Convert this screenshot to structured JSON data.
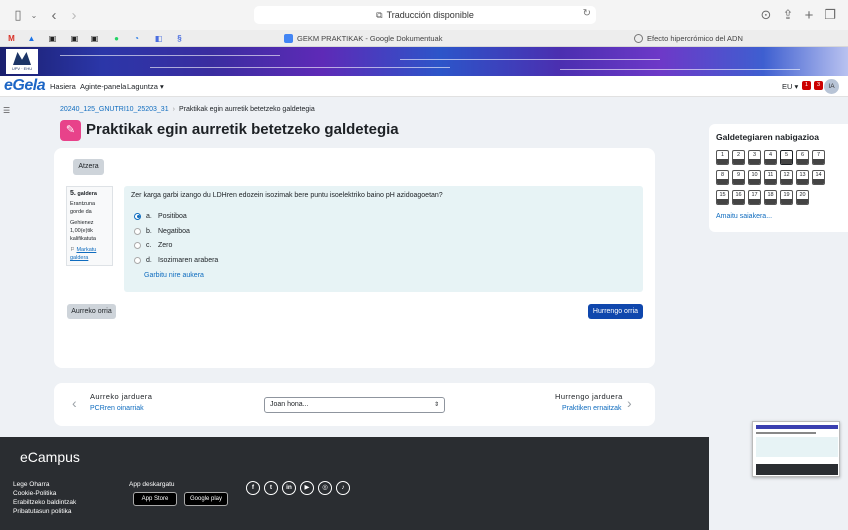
{
  "browser": {
    "address_text": "Traducción disponible",
    "tabs": [
      {
        "label": "GEKM PRAKTIKAK - Google Dokumentuak"
      },
      {
        "label": "Efecto hipercrómico del ADN"
      }
    ],
    "favorites": [
      {
        "icon": "gmail-icon",
        "glyph": "M",
        "color": "#d93025"
      },
      {
        "icon": "drive-icon",
        "glyph": "▲",
        "color": "#1a73e8"
      },
      {
        "icon": "bookmark-1-icon",
        "glyph": "▣",
        "color": "#222"
      },
      {
        "icon": "bookmark-2-icon",
        "glyph": "▣",
        "color": "#222"
      },
      {
        "icon": "bookmark-3-icon",
        "glyph": "▣",
        "color": "#222"
      },
      {
        "icon": "whatsapp-icon",
        "glyph": "●",
        "color": "#25d366"
      },
      {
        "icon": "bookmark-4-icon",
        "glyph": "◔",
        "color": "#1a73e8"
      },
      {
        "icon": "bookmark-5-icon",
        "glyph": "◧",
        "color": "#4a6ee0"
      },
      {
        "icon": "bookmark-6-icon",
        "glyph": "§",
        "color": "#4a6ee0"
      }
    ]
  },
  "nav": {
    "brand": "eGela",
    "links": [
      "Hasiera",
      "Aginte-panela",
      "Laguntza"
    ],
    "lang": "EU",
    "notifications": "1",
    "messages": "3",
    "avatar": "IA"
  },
  "breadcrumb": {
    "course": "20240_125_GNUTRI10_25203_31",
    "current": "Praktikak egin aurretik betetzeko galdetegia"
  },
  "page_title": "Praktikak egin aurretik betetzeko galdetegia",
  "back_button": "Atzera",
  "question_info": {
    "number": "5.",
    "label": "galdera",
    "status": "Erantzuna gorde da",
    "marks": "Gehienez 1,00(e)tik kalifikatuta",
    "flag": "Markatu galdera"
  },
  "question": {
    "text": "Zer karga garbi izango du LDHren edozein isozimak bere puntu isoelektriko baino pH azidoagoetan?",
    "options": [
      {
        "letter": "a.",
        "label": "Positiboa",
        "selected": true
      },
      {
        "letter": "b.",
        "label": "Negatiboa",
        "selected": false
      },
      {
        "letter": "c.",
        "label": "Zero",
        "selected": false
      },
      {
        "letter": "d.",
        "label": "Isozimaren arabera",
        "selected": false
      }
    ],
    "clear": "Garbitu nire aukera"
  },
  "prev_page": "Aurreko orria",
  "next_page": "Hurrengo orria",
  "activity_nav": {
    "prev_heading": "Aurreko jarduera",
    "prev_link": "PCRren oinarriak",
    "jump_placeholder": "Joan hona...",
    "next_heading": "Hurrengo jarduera",
    "next_link": "Praktiken ernaitzak"
  },
  "quiz_nav": {
    "title": "Galdetegiaren nabigazioa",
    "questions": [
      "1",
      "2",
      "3",
      "4",
      "5",
      "6",
      "7",
      "8",
      "9",
      "10",
      "11",
      "12",
      "13",
      "14",
      "15",
      "16",
      "17",
      "18",
      "19",
      "20"
    ],
    "current": "5",
    "finish": "Amaitu saiakera..."
  },
  "footer": {
    "brand": "eCampus",
    "links": [
      "Lege Oharra",
      "Cookie-Politika",
      "Erabiltzeko baldintzak",
      "Pribatutasun politika"
    ],
    "app_title": "App deskargatu",
    "stores": [
      "App Store",
      "Google play"
    ],
    "socials": [
      {
        "icon": "facebook-icon",
        "glyph": "f"
      },
      {
        "icon": "twitter-icon",
        "glyph": "t"
      },
      {
        "icon": "linkedin-icon",
        "glyph": "in"
      },
      {
        "icon": "youtube-icon",
        "glyph": "▶"
      },
      {
        "icon": "instagram-icon",
        "glyph": "◎"
      },
      {
        "icon": "tiktok-icon",
        "glyph": "♪"
      }
    ]
  }
}
